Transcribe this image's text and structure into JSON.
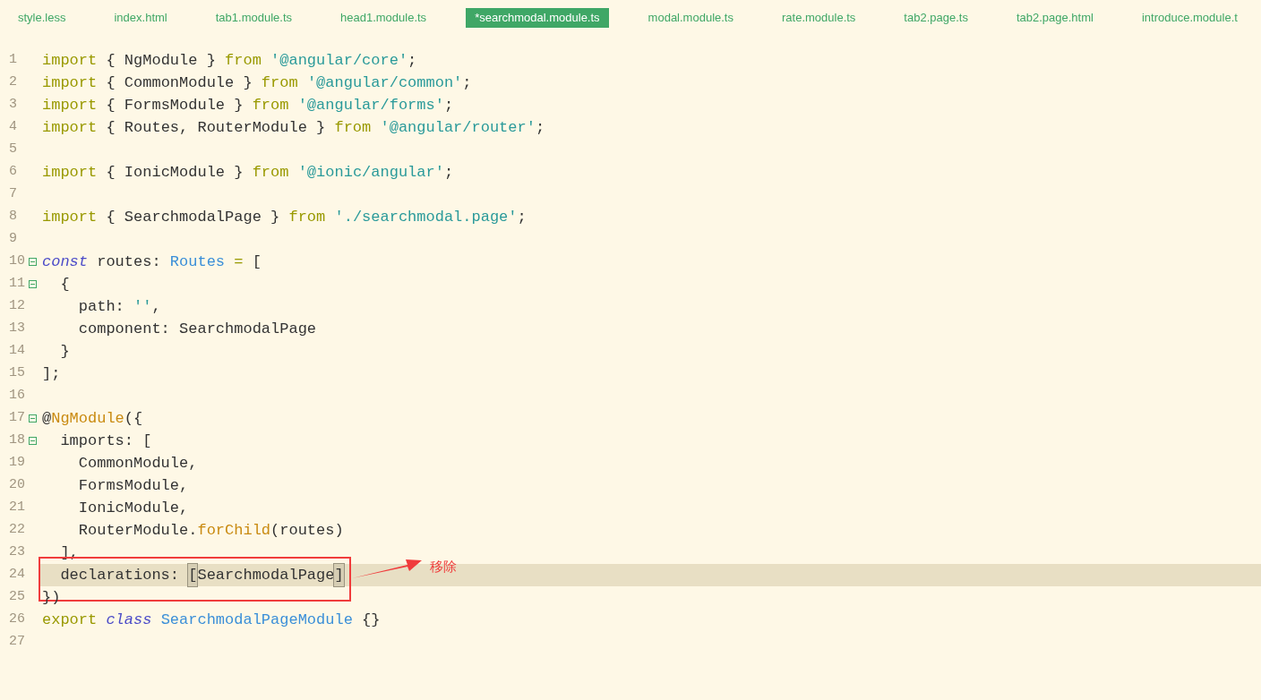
{
  "tabs": [
    {
      "label": "style.less",
      "selected": false
    },
    {
      "label": "index.html",
      "selected": false
    },
    {
      "label": "tab1.module.ts",
      "selected": false
    },
    {
      "label": "head1.module.ts",
      "selected": false
    },
    {
      "label": "*searchmodal.module.ts",
      "selected": true
    },
    {
      "label": "modal.module.ts",
      "selected": false
    },
    {
      "label": "rate.module.ts",
      "selected": false
    },
    {
      "label": "tab2.page.ts",
      "selected": false
    },
    {
      "label": "tab2.page.html",
      "selected": false
    },
    {
      "label": "introduce.module.t",
      "selected": false
    }
  ],
  "lines": [
    {
      "n": "1",
      "tokens": [
        {
          "t": "import",
          "kind": "kw"
        },
        {
          "t": " { NgModule } ",
          "kind": "plain"
        },
        {
          "t": "from ",
          "kind": "kw"
        },
        {
          "t": "'@angular/core'",
          "kind": "str"
        },
        {
          "t": ";",
          "kind": "plain"
        }
      ]
    },
    {
      "n": "2",
      "tokens": [
        {
          "t": "import",
          "kind": "kw"
        },
        {
          "t": " { CommonModule } ",
          "kind": "plain"
        },
        {
          "t": "from ",
          "kind": "kw"
        },
        {
          "t": "'@angular/common'",
          "kind": "str"
        },
        {
          "t": ";",
          "kind": "plain"
        }
      ]
    },
    {
      "n": "3",
      "tokens": [
        {
          "t": "import",
          "kind": "kw"
        },
        {
          "t": " { FormsModule } ",
          "kind": "plain"
        },
        {
          "t": "from ",
          "kind": "kw"
        },
        {
          "t": "'@angular/forms'",
          "kind": "str"
        },
        {
          "t": ";",
          "kind": "plain"
        }
      ]
    },
    {
      "n": "4",
      "tokens": [
        {
          "t": "import",
          "kind": "kw"
        },
        {
          "t": " { Routes, RouterModule } ",
          "kind": "plain"
        },
        {
          "t": "from ",
          "kind": "kw"
        },
        {
          "t": "'@angular/router'",
          "kind": "str"
        },
        {
          "t": ";",
          "kind": "plain"
        }
      ]
    },
    {
      "n": "5"
    },
    {
      "n": "6",
      "tokens": [
        {
          "t": "import",
          "kind": "kw"
        },
        {
          "t": " { IonicModule } ",
          "kind": "plain"
        },
        {
          "t": "from ",
          "kind": "kw"
        },
        {
          "t": "'@ionic/angular'",
          "kind": "str"
        },
        {
          "t": ";",
          "kind": "plain"
        }
      ]
    },
    {
      "n": "7"
    },
    {
      "n": "8",
      "tokens": [
        {
          "t": "import",
          "kind": "kw"
        },
        {
          "t": " { SearchmodalPage } ",
          "kind": "plain"
        },
        {
          "t": "from ",
          "kind": "kw"
        },
        {
          "t": "'./searchmodal.page'",
          "kind": "str"
        },
        {
          "t": ";",
          "kind": "plain"
        }
      ]
    },
    {
      "n": "9"
    },
    {
      "n": "10",
      "fold": true,
      "tokens": [
        {
          "t": "const",
          "kind": "storage"
        },
        {
          "t": " routes: ",
          "kind": "plain"
        },
        {
          "t": "Routes",
          "kind": "type"
        },
        {
          "t": " = ",
          "kind": "kw"
        },
        {
          "t": "[",
          "kind": "plain"
        }
      ]
    },
    {
      "n": "11",
      "fold": true,
      "tokens": [
        {
          "t": "  {",
          "kind": "plain"
        }
      ]
    },
    {
      "n": "12",
      "tokens": [
        {
          "t": "    path: ",
          "kind": "plain"
        },
        {
          "t": "''",
          "kind": "str"
        },
        {
          "t": ",",
          "kind": "plain"
        }
      ]
    },
    {
      "n": "13",
      "tokens": [
        {
          "t": "    component: SearchmodalPage",
          "kind": "plain"
        }
      ]
    },
    {
      "n": "14",
      "tokens": [
        {
          "t": "  }",
          "kind": "plain"
        }
      ]
    },
    {
      "n": "15",
      "tokens": [
        {
          "t": "];",
          "kind": "plain"
        }
      ]
    },
    {
      "n": "16"
    },
    {
      "n": "17",
      "fold": true,
      "tokens": [
        {
          "t": "@",
          "kind": "plain"
        },
        {
          "t": "NgModule",
          "kind": "fn"
        },
        {
          "t": "({",
          "kind": "plain"
        }
      ]
    },
    {
      "n": "18",
      "fold": true,
      "tokens": [
        {
          "t": "  imports: [",
          "kind": "plain"
        }
      ]
    },
    {
      "n": "19",
      "tokens": [
        {
          "t": "    CommonModule,",
          "kind": "plain"
        }
      ]
    },
    {
      "n": "20",
      "tokens": [
        {
          "t": "    FormsModule,",
          "kind": "plain"
        }
      ]
    },
    {
      "n": "21",
      "tokens": [
        {
          "t": "    IonicModule,",
          "kind": "plain"
        }
      ]
    },
    {
      "n": "22",
      "tokens": [
        {
          "t": "    RouterModule.",
          "kind": "plain"
        },
        {
          "t": "forChild",
          "kind": "fn"
        },
        {
          "t": "(routes)",
          "kind": "plain"
        }
      ]
    },
    {
      "n": "23",
      "tokens": [
        {
          "t": "  ],",
          "kind": "plain"
        }
      ]
    },
    {
      "n": "24",
      "highlighted": true,
      "annotation": {
        "label": "移除"
      },
      "tokens": [
        {
          "t": "  declarations: ",
          "kind": "plain"
        },
        {
          "t": "[",
          "kind": "match"
        },
        {
          "t": "SearchmodalPage",
          "kind": "plain"
        },
        {
          "t": "]",
          "kind": "match"
        }
      ]
    },
    {
      "n": "25",
      "tokens": [
        {
          "t": "})",
          "kind": "plain"
        }
      ]
    },
    {
      "n": "26",
      "tokens": [
        {
          "t": "export ",
          "kind": "kw"
        },
        {
          "t": "class ",
          "kind": "storage"
        },
        {
          "t": "SearchmodalPageModule",
          "kind": "type"
        },
        {
          "t": " {}",
          "kind": "plain"
        }
      ]
    },
    {
      "n": "27"
    }
  ]
}
